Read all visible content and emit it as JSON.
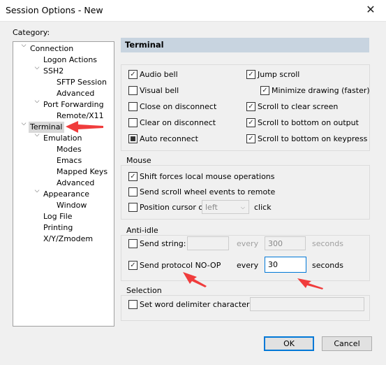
{
  "window": {
    "title": "Session Options - New",
    "close_icon": "close-icon"
  },
  "category_label": "Category:",
  "tree": [
    {
      "label": "Connection",
      "level": 0,
      "expanded": true
    },
    {
      "label": "Logon Actions",
      "level": 1
    },
    {
      "label": "SSH2",
      "level": 1,
      "expanded": true
    },
    {
      "label": "SFTP Session",
      "level": 2
    },
    {
      "label": "Advanced",
      "level": 2
    },
    {
      "label": "Port Forwarding",
      "level": 1,
      "expanded": true
    },
    {
      "label": "Remote/X11",
      "level": 2
    },
    {
      "label": "Terminal",
      "level": 0,
      "expanded": true,
      "selected": true
    },
    {
      "label": "Emulation",
      "level": 1,
      "expanded": true
    },
    {
      "label": "Modes",
      "level": 2
    },
    {
      "label": "Emacs",
      "level": 2
    },
    {
      "label": "Mapped Keys",
      "level": 2
    },
    {
      "label": "Advanced",
      "level": 2
    },
    {
      "label": "Appearance",
      "level": 1,
      "expanded": true
    },
    {
      "label": "Window",
      "level": 2
    },
    {
      "label": "Log File",
      "level": 1
    },
    {
      "label": "Printing",
      "level": 1
    },
    {
      "label": "X/Y/Zmodem",
      "level": 1
    }
  ],
  "header": "Terminal",
  "terminal_left": [
    {
      "label": "Audio bell",
      "state": "checked"
    },
    {
      "label": "Visual bell",
      "state": "unchecked"
    },
    {
      "label": "Close on disconnect",
      "state": "unchecked"
    },
    {
      "label": "Clear on disconnect",
      "state": "unchecked"
    },
    {
      "label": "Auto reconnect",
      "state": "indeterminate"
    }
  ],
  "terminal_right": [
    {
      "label": "Jump scroll",
      "state": "checked"
    },
    {
      "label": "Minimize drawing (faster)",
      "state": "checked"
    },
    {
      "label": "Scroll to clear screen",
      "state": "checked"
    },
    {
      "label": "Scroll to bottom on output",
      "state": "checked"
    },
    {
      "label": "Scroll to bottom on keypress",
      "state": "checked"
    }
  ],
  "mouse": {
    "label": "Mouse",
    "shift": "Shift forces local mouse operations",
    "shift_state": "checked",
    "wheel": "Send scroll wheel events to remote",
    "wheel_state": "unchecked",
    "position": "Position cursor on",
    "position_state": "unchecked",
    "position_value": "left",
    "click": "click"
  },
  "anti_idle": {
    "label": "Anti-idle",
    "send_string": "Send string:",
    "send_string_state": "unchecked",
    "send_string_value": "",
    "every": "every",
    "string_seconds": "300",
    "seconds": "seconds",
    "noop": "Send protocol NO-OP",
    "noop_state": "checked",
    "noop_seconds": "30"
  },
  "selection": {
    "label": "Selection",
    "delim": "Set word delimiter characters:",
    "delim_state": "unchecked",
    "delim_value": ""
  },
  "buttons": {
    "ok": "OK",
    "cancel": "Cancel"
  },
  "annotation_color": "#f03c3c"
}
